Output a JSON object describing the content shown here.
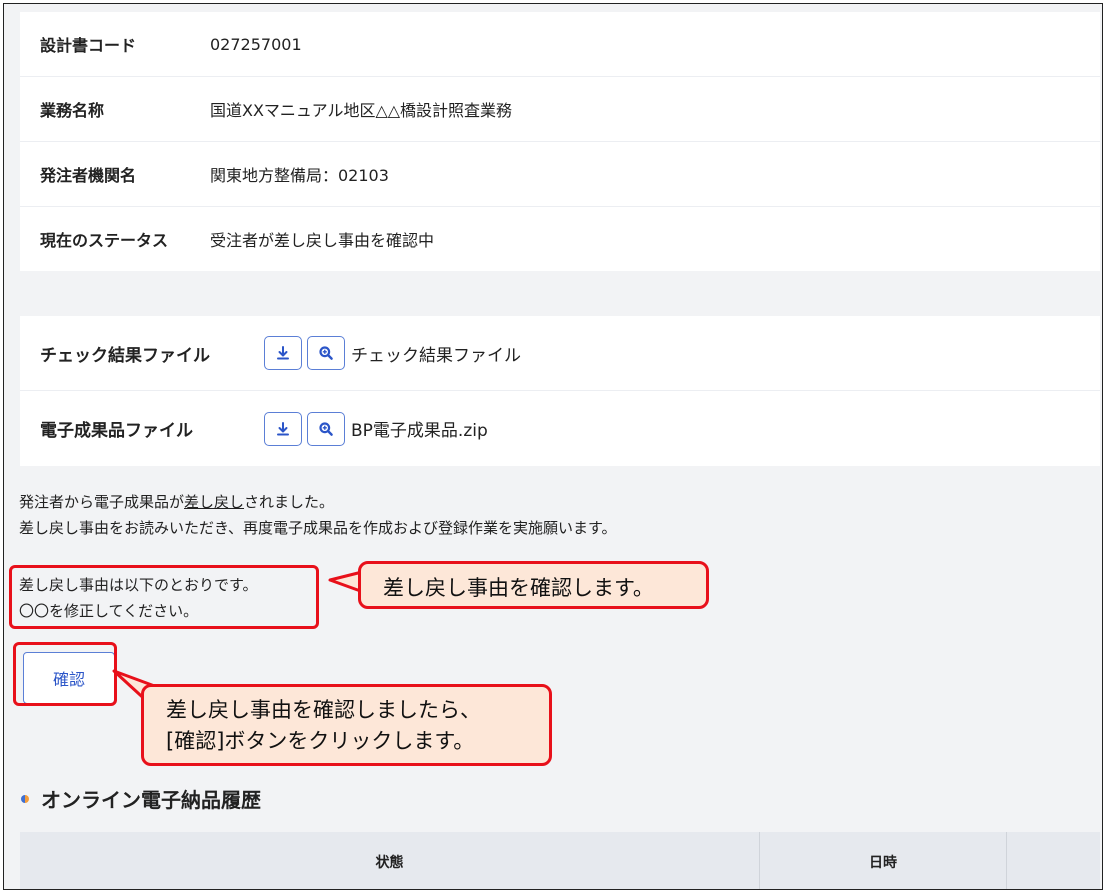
{
  "info": {
    "rows": [
      {
        "label": "設計書コード",
        "value": "027257001"
      },
      {
        "label": "業務名称",
        "value": "国道XXマニュアル地区△△橋設計照査業務"
      },
      {
        "label": "発注者機関名",
        "value": "関東地方整備局：02103"
      },
      {
        "label": "現在のステータス",
        "value": "受注者が差し戻し事由を確認中"
      }
    ]
  },
  "files": {
    "rows": [
      {
        "label": "チェック結果ファイル",
        "file": "チェック結果ファイル",
        "download_icon": "download-icon",
        "preview_icon": "search-icon"
      },
      {
        "label": "電子成果品ファイル",
        "file": "BP電子成果品.zip",
        "download_icon": "download-icon",
        "preview_icon": "search-icon"
      }
    ]
  },
  "message": {
    "line1_pre": "発注者から電子成果品が",
    "line1_link": "差し戻し",
    "line1_post": "されました。",
    "line2": "差し戻し事由をお読みいただき、再度電子成果品を作成および登録作業を実施願います。",
    "reason_line1": "差し戻し事由は以下のとおりです。",
    "reason_line2": "〇〇を修正してください。"
  },
  "confirm_button": {
    "label": "確認"
  },
  "callouts": {
    "reason": "差し戻し事由を確認します。",
    "confirm_line1": "差し戻し事由を確認しましたら、",
    "confirm_line2": "[確認]ボタンをクリックします。"
  },
  "history": {
    "title": "オンライン電子納品履歴",
    "columns": [
      "状態",
      "日時",
      ""
    ]
  },
  "colors": {
    "highlight": "#e8101a",
    "callout_bg": "#fde7d8",
    "button_border": "#5b7fd6",
    "button_text": "#2b55c8"
  }
}
